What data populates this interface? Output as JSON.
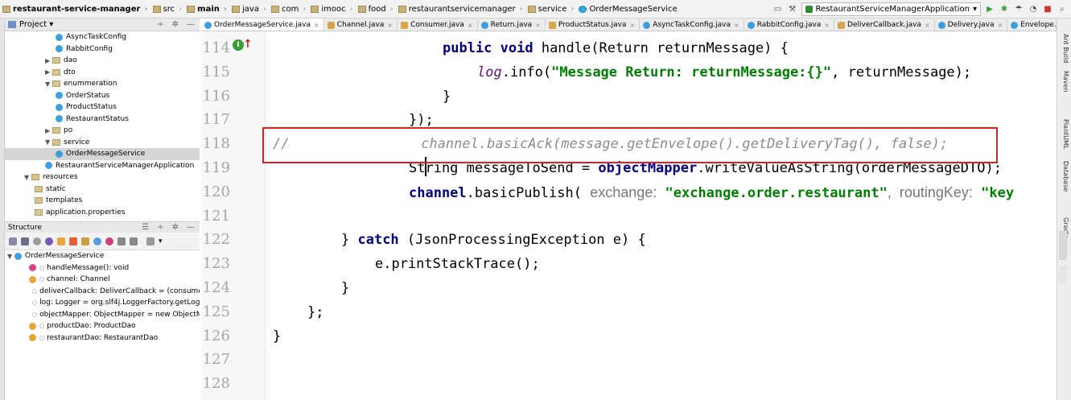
{
  "breadcrumb": [
    "restaurant-service-manager",
    "src",
    "main",
    "java",
    "com",
    "imooc",
    "food",
    "restaurantservicemanager",
    "service",
    "OrderMessageService"
  ],
  "run_config": "RestaurantServiceManagerApplication",
  "project_panel": {
    "title": "Project",
    "tree": [
      {
        "label": "AsyncTaskConfig",
        "kind": "class",
        "indent": 5
      },
      {
        "label": "RabbitConfig",
        "kind": "class",
        "indent": 5
      },
      {
        "label": "dao",
        "kind": "folder",
        "indent": 4
      },
      {
        "label": "dto",
        "kind": "folder",
        "indent": 4
      },
      {
        "label": "enummeration",
        "kind": "folder-open",
        "indent": 4
      },
      {
        "label": "OrderStatus",
        "kind": "class",
        "indent": 5
      },
      {
        "label": "ProductStatus",
        "kind": "class",
        "indent": 5
      },
      {
        "label": "RestaurantStatus",
        "kind": "class",
        "indent": 5
      },
      {
        "label": "po",
        "kind": "folder",
        "indent": 4
      },
      {
        "label": "service",
        "kind": "folder-open",
        "indent": 4
      },
      {
        "label": "OrderMessageService",
        "kind": "class",
        "indent": 5,
        "selected": true
      },
      {
        "label": "RestaurantServiceManagerApplication",
        "kind": "class",
        "indent": 4
      },
      {
        "label": "resources",
        "kind": "folder-open",
        "indent": 2
      },
      {
        "label": "static",
        "kind": "plain",
        "indent": 3
      },
      {
        "label": "templates",
        "kind": "plain",
        "indent": 3
      },
      {
        "label": "application.properties",
        "kind": "props",
        "indent": 3
      }
    ]
  },
  "structure_panel": {
    "title": "Structure",
    "root": "OrderMessageService",
    "members": [
      {
        "label": "handleMessage(): void",
        "kind": "method"
      },
      {
        "label": "channel: Channel",
        "kind": "field"
      },
      {
        "label": "deliverCallback: DeliverCallback = (consumerTa",
        "kind": "field"
      },
      {
        "label": "log: Logger = org.slf4j.LoggerFactory.getLogge",
        "kind": "field"
      },
      {
        "label": "objectMapper: ObjectMapper = new ObjectMa",
        "kind": "field"
      },
      {
        "label": "productDao: ProductDao",
        "kind": "field"
      },
      {
        "label": "restaurantDao: RestaurantDao",
        "kind": "field"
      }
    ]
  },
  "tabs": [
    {
      "label": "OrderMessageService.java",
      "active": true,
      "icon": "class"
    },
    {
      "label": "Channel.java",
      "icon": "interface"
    },
    {
      "label": "Consumer.java",
      "icon": "interface"
    },
    {
      "label": "Return.java",
      "icon": "class"
    },
    {
      "label": "ProductStatus.java",
      "icon": "enum"
    },
    {
      "label": "AsyncTaskConfig.java",
      "icon": "class"
    },
    {
      "label": "RabbitConfig.java",
      "icon": "class"
    },
    {
      "label": "DeliverCallback.java",
      "icon": "interface"
    },
    {
      "label": "Delivery.java",
      "icon": "class"
    },
    {
      "label": "Envelope.java",
      "icon": "class"
    }
  ],
  "editor": {
    "lines": [
      {
        "num": "114",
        "text_a": "public void ",
        "text_b": "handle(Return returnMessage) {"
      },
      {
        "num": "115",
        "text_a": "log",
        "text_b": ".info(",
        "str": "\"Message Return: returnMessage:{}\"",
        "text_c": ", returnMessage);"
      },
      {
        "num": "116",
        "text_a": "}"
      },
      {
        "num": "117",
        "text_a": "});"
      },
      {
        "num": "118",
        "comment": "//                channel.basicAck(message.getEnvelope().getDeliveryTag(), false);"
      },
      {
        "num": "119",
        "text_a": "String messageToSend = ",
        "text_b": "objectMapper",
        "text_c": ".writeValueAsString(orderMessageDTO);"
      },
      {
        "num": "120",
        "text_a": "channel",
        "text_b": ".basicPublish( ",
        "hint1": "exchange:",
        "str": " \"exchange.order.restaurant\"",
        "hint2": ",  routingKey:",
        "str2": " \"key"
      },
      {
        "num": "121"
      },
      {
        "num": "122",
        "text_a": "} ",
        "kw": "catch",
        "text_b": " (JsonProcessingException e) {"
      },
      {
        "num": "123",
        "text_a": "e.printStackTrace();"
      },
      {
        "num": "124",
        "text_a": "}"
      },
      {
        "num": "125",
        "text_a": "};"
      },
      {
        "num": "126",
        "text_a": "}"
      },
      {
        "num": "127"
      },
      {
        "num": "128"
      }
    ]
  },
  "right_tools": [
    "Ant Build",
    "Maven",
    "PlantUML",
    "Database",
    "Gradle"
  ],
  "colors": {
    "highlight_box": "#e02020",
    "keyword": "#000080",
    "string": "#008000",
    "comment": "#8c8c8c"
  }
}
